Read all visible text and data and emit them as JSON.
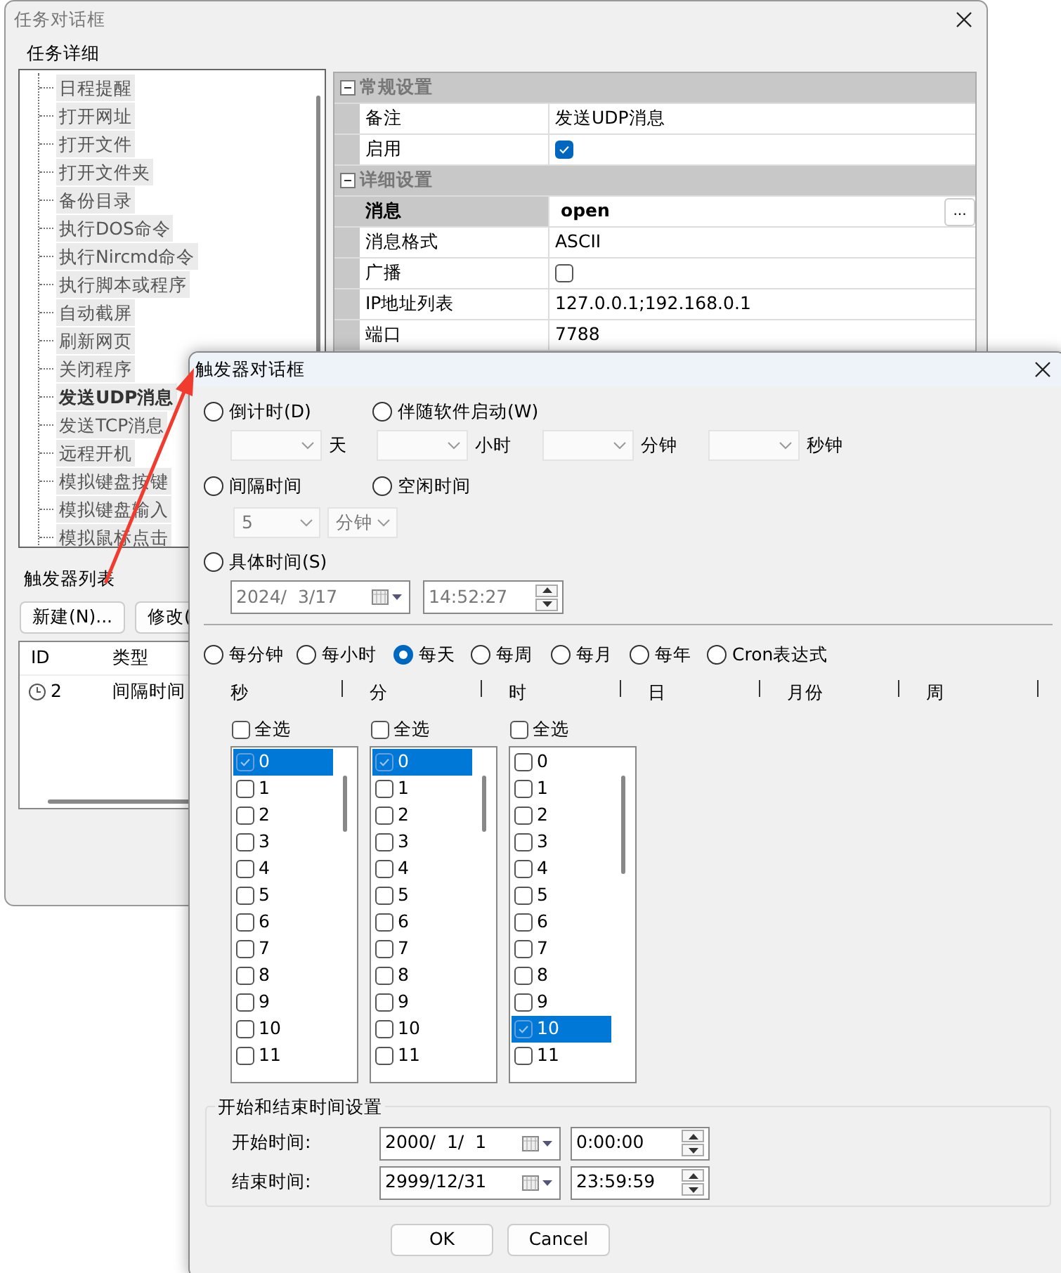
{
  "task_window": {
    "title": "任务对话框",
    "details": {
      "title": "任务详细",
      "tree": [
        {
          "label": "日程提醒",
          "selected": false
        },
        {
          "label": "打开网址",
          "selected": false
        },
        {
          "label": "打开文件",
          "selected": false
        },
        {
          "label": "打开文件夹",
          "selected": false
        },
        {
          "label": "备份目录",
          "selected": false
        },
        {
          "label": "执行DOS命令",
          "selected": false
        },
        {
          "label": "执行Nircmd命令",
          "selected": false
        },
        {
          "label": "执行脚本或程序",
          "selected": false
        },
        {
          "label": "自动截屏",
          "selected": false
        },
        {
          "label": "刷新网页",
          "selected": false
        },
        {
          "label": "关闭程序",
          "selected": false
        },
        {
          "label": "发送UDP消息",
          "selected": true
        },
        {
          "label": "发送TCP消息",
          "selected": false
        },
        {
          "label": "远程开机",
          "selected": false
        },
        {
          "label": "模拟键盘按键",
          "selected": false
        },
        {
          "label": "模拟键盘输入",
          "selected": false
        },
        {
          "label": "模拟鼠标点击",
          "selected": false
        }
      ],
      "properties": [
        {
          "kind": "category",
          "label": "常规设置",
          "expanded": true
        },
        {
          "kind": "text",
          "name": "备注",
          "value": "发送UDP消息",
          "selected": false
        },
        {
          "kind": "checkbox",
          "name": "启用",
          "checked": true,
          "selected": false
        },
        {
          "kind": "category",
          "label": "详细设置",
          "expanded": true
        },
        {
          "kind": "button",
          "name": "消息",
          "value": "open",
          "button": "...",
          "selected": true
        },
        {
          "kind": "text",
          "name": "消息格式",
          "value": "ASCII",
          "selected": false
        },
        {
          "kind": "checkbox",
          "name": "广播",
          "checked": false,
          "selected": false
        },
        {
          "kind": "text",
          "name": "IP地址列表",
          "value": "127.0.0.1;192.168.0.1",
          "selected": false
        },
        {
          "kind": "text",
          "name": "端口",
          "value": "7788",
          "selected": false
        }
      ]
    },
    "triggers": {
      "title": "触发器列表",
      "buttons": [
        "新建(N)...",
        "修改("
      ],
      "columns": [
        "ID",
        "类型"
      ],
      "rows": [
        {
          "id": "2",
          "type": "间隔时间"
        }
      ]
    }
  },
  "trigger_dialog": {
    "title": "触发器对话框",
    "modes": [
      {
        "label": "倒计时(D)",
        "selected": false
      },
      {
        "label": "伴随软件启动(W)",
        "selected": false
      },
      {
        "label": "间隔时间",
        "selected": false
      },
      {
        "label": "空闲时间",
        "selected": false
      },
      {
        "label": "具体时间(S)",
        "selected": false
      }
    ],
    "countdown": [
      {
        "unit": "天"
      },
      {
        "unit": "小时"
      },
      {
        "unit": "分钟"
      },
      {
        "unit": "秒钟"
      }
    ],
    "interval": {
      "value": "5",
      "unit": "分钟"
    },
    "specific": {
      "date": "2024/  3/17",
      "time": "14:52:27"
    },
    "frequencies": [
      {
        "label": "每分钟",
        "selected": false
      },
      {
        "label": "每小时",
        "selected": false
      },
      {
        "label": "每天",
        "selected": true
      },
      {
        "label": "每周",
        "selected": false
      },
      {
        "label": "每月",
        "selected": false
      },
      {
        "label": "每年",
        "selected": false
      },
      {
        "label": "Cron表达式",
        "selected": false
      }
    ],
    "fields": [
      "秒",
      "分",
      "时",
      "日",
      "月份",
      "周"
    ],
    "lists": [
      {
        "select_all": {
          "label": "全选",
          "checked": false
        },
        "items": [
          {
            "label": "0",
            "checked": true,
            "selected": true
          },
          {
            "label": "1",
            "checked": false,
            "selected": false
          },
          {
            "label": "2",
            "checked": false,
            "selected": false
          },
          {
            "label": "3",
            "checked": false,
            "selected": false
          },
          {
            "label": "4",
            "checked": false,
            "selected": false
          },
          {
            "label": "5",
            "checked": false,
            "selected": false
          },
          {
            "label": "6",
            "checked": false,
            "selected": false
          },
          {
            "label": "7",
            "checked": false,
            "selected": false
          },
          {
            "label": "8",
            "checked": false,
            "selected": false
          },
          {
            "label": "9",
            "checked": false,
            "selected": false
          },
          {
            "label": "10",
            "checked": false,
            "selected": false
          },
          {
            "label": "11",
            "checked": false,
            "selected": false
          }
        ]
      },
      {
        "select_all": {
          "label": "全选",
          "checked": false
        },
        "items": [
          {
            "label": "0",
            "checked": true,
            "selected": true
          },
          {
            "label": "1",
            "checked": false,
            "selected": false
          },
          {
            "label": "2",
            "checked": false,
            "selected": false
          },
          {
            "label": "3",
            "checked": false,
            "selected": false
          },
          {
            "label": "4",
            "checked": false,
            "selected": false
          },
          {
            "label": "5",
            "checked": false,
            "selected": false
          },
          {
            "label": "6",
            "checked": false,
            "selected": false
          },
          {
            "label": "7",
            "checked": false,
            "selected": false
          },
          {
            "label": "8",
            "checked": false,
            "selected": false
          },
          {
            "label": "9",
            "checked": false,
            "selected": false
          },
          {
            "label": "10",
            "checked": false,
            "selected": false
          },
          {
            "label": "11",
            "checked": false,
            "selected": false
          }
        ]
      },
      {
        "select_all": {
          "label": "全选",
          "checked": false
        },
        "items": [
          {
            "label": "0",
            "checked": false,
            "selected": false
          },
          {
            "label": "1",
            "checked": false,
            "selected": false
          },
          {
            "label": "2",
            "checked": false,
            "selected": false
          },
          {
            "label": "3",
            "checked": false,
            "selected": false
          },
          {
            "label": "4",
            "checked": false,
            "selected": false
          },
          {
            "label": "5",
            "checked": false,
            "selected": false
          },
          {
            "label": "6",
            "checked": false,
            "selected": false
          },
          {
            "label": "7",
            "checked": false,
            "selected": false
          },
          {
            "label": "8",
            "checked": false,
            "selected": false
          },
          {
            "label": "9",
            "checked": false,
            "selected": false
          },
          {
            "label": "10",
            "checked": true,
            "selected": true
          },
          {
            "label": "11",
            "checked": false,
            "selected": false
          }
        ]
      }
    ],
    "range": {
      "title": "开始和结束时间设置",
      "rows": [
        {
          "label": "开始时间:",
          "date": "2000/  1/  1",
          "time": "0:00:00"
        },
        {
          "label": "结束时间:",
          "date": "2999/12/31",
          "time": "23:59:59"
        }
      ]
    },
    "buttons": [
      "OK",
      "Cancel"
    ]
  }
}
